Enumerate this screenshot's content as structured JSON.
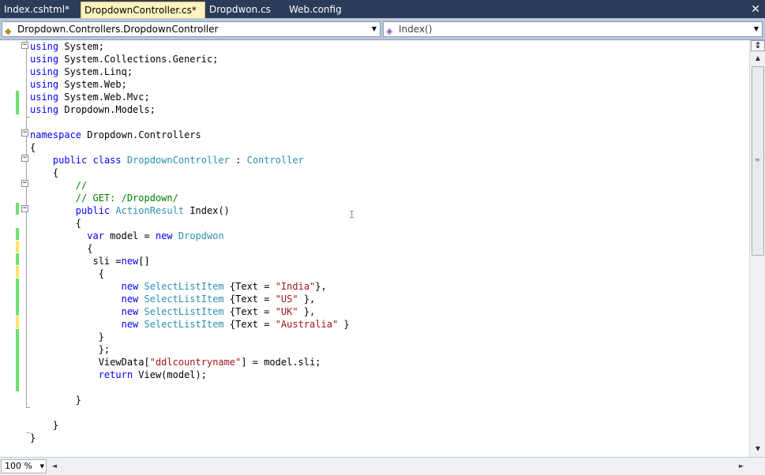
{
  "tabs": [
    {
      "label": "Index.cshtml*",
      "active": false
    },
    {
      "label": "DropdownController.cs*",
      "active": true
    },
    {
      "label": "Dropdwon.cs",
      "active": false
    },
    {
      "label": "Web.config",
      "active": false
    }
  ],
  "navbar": {
    "type_combo": "Dropdown.Controllers.DropdownController",
    "member_combo": "Index()"
  },
  "code_lines": [
    "using System;",
    "using System.Collections.Generic;",
    "using System.Linq;",
    "using System.Web;",
    "using System.Web.Mvc;",
    "using Dropdown.Models;",
    "",
    "namespace Dropdown.Controllers",
    "{",
    "    public class DropdownController : Controller",
    "    {",
    "        //",
    "        // GET: /Dropdown/",
    "        public ActionResult Index()",
    "        {",
    "          var model = new Dropdwon",
    "          {",
    "           sli =new[]",
    "            {",
    "                new SelectListItem {Text = \"India\"},",
    "                new SelectListItem {Text = \"US\" },",
    "                new SelectListItem {Text = \"UK\" },",
    "                new SelectListItem {Text = \"Australia\" }",
    "            }",
    "            };",
    "            ViewData[\"ddlcountryname\"] = model.sli;",
    "            return View(model);",
    "",
    "        }",
    "",
    "    }",
    "}"
  ],
  "statusbar": {
    "zoom": "100 %"
  },
  "colors": {
    "tab_strip": "#2b3c59",
    "active_tab": "#fdf4bf",
    "keyword": "#0000ff",
    "type": "#2b91af",
    "comment": "#008000",
    "string": "#a31515",
    "change_saved": "#6ce26c",
    "change_unsaved": "#fde46a"
  }
}
